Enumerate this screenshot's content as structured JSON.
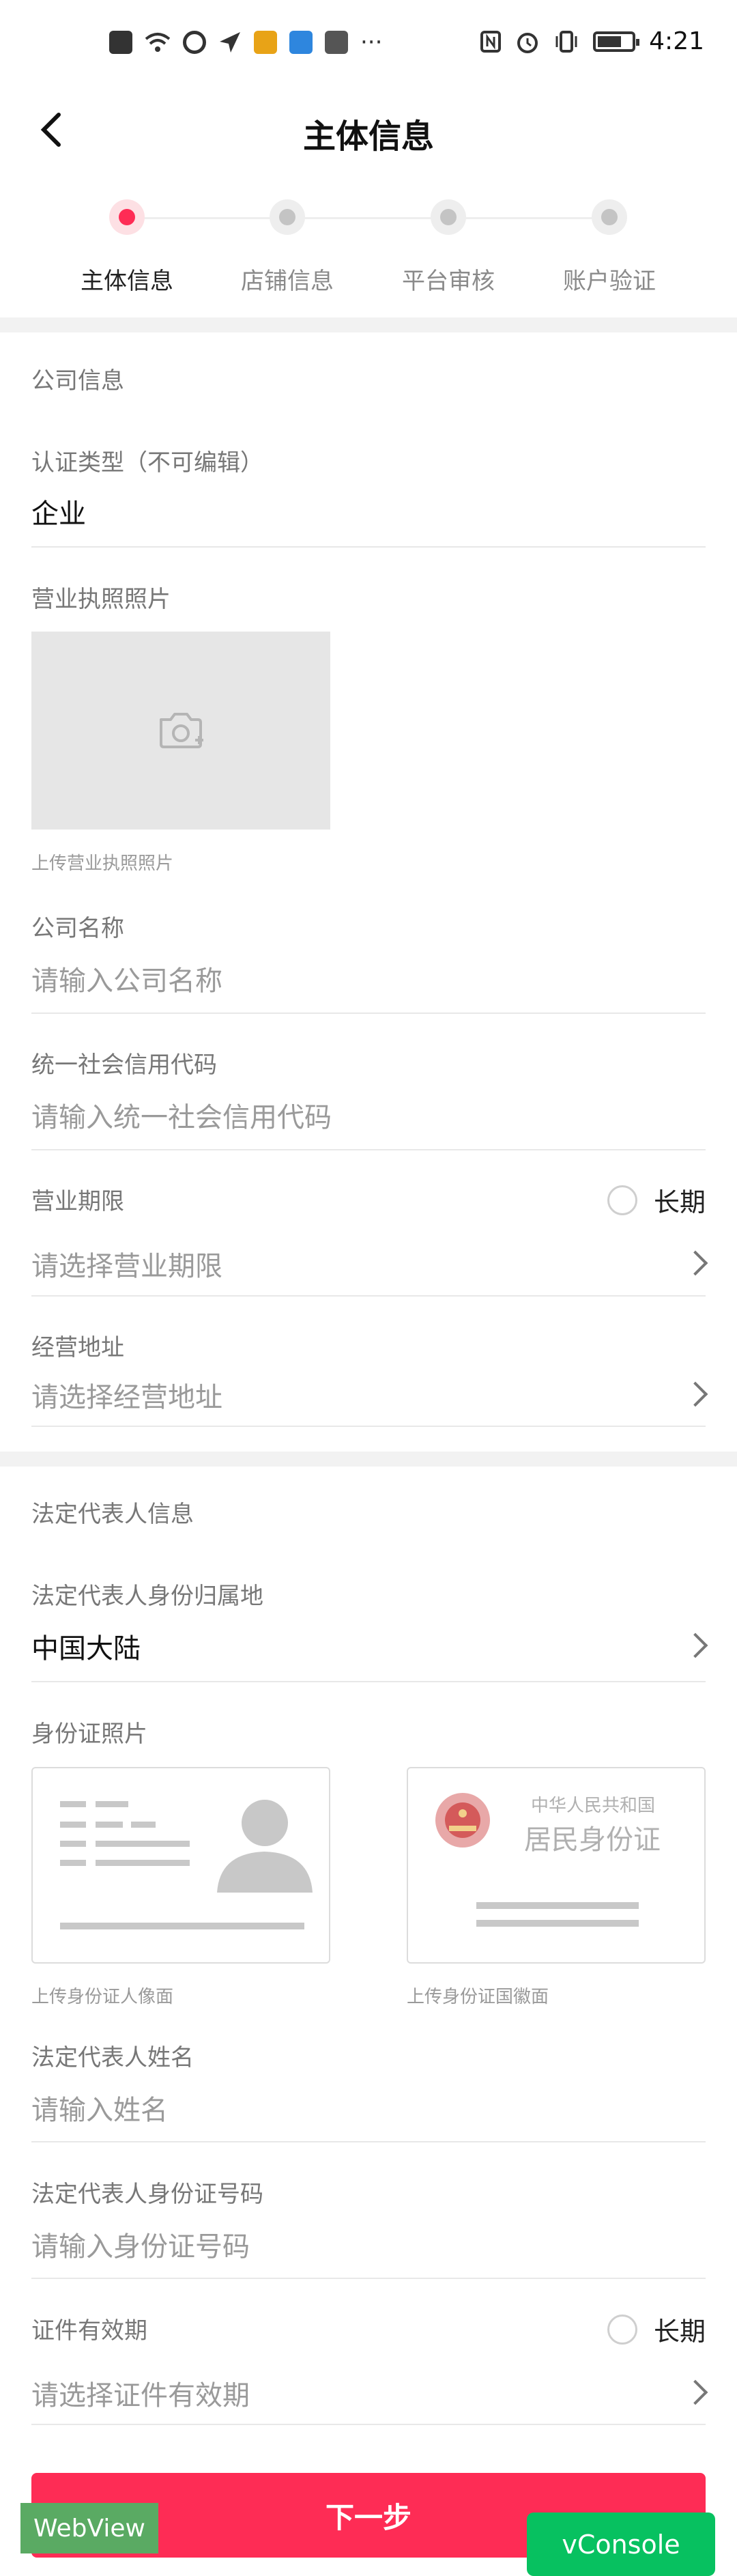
{
  "status_bar": {
    "time": "4:21",
    "left_icons": [
      "notification-icon",
      "wifi-icon",
      "shazam-icon",
      "location-icon",
      "app-icon",
      "gallery-icon",
      "mail-icon"
    ],
    "right_icons": [
      "nfc-icon",
      "alarm-icon",
      "vibrate-icon",
      "battery-icon"
    ],
    "more": "···"
  },
  "header": {
    "title": "主体信息",
    "back_icon": "chevron-left-icon"
  },
  "stepper": {
    "steps": [
      {
        "label": "主体信息",
        "active": true
      },
      {
        "label": "店铺信息",
        "active": false
      },
      {
        "label": "平台审核",
        "active": false
      },
      {
        "label": "账户验证",
        "active": false
      }
    ]
  },
  "company": {
    "section_title": "公司信息",
    "cert_type_label": "认证类型（不可编辑）",
    "cert_type_value": "企业",
    "license_photo_label": "营业执照照片",
    "license_upload_hint": "上传营业执照照片",
    "name_label": "公司名称",
    "name_placeholder": "请输入公司名称",
    "credit_code_label": "统一社会信用代码",
    "credit_code_placeholder": "请输入统一社会信用代码",
    "term_label": "营业期限",
    "term_long_label": "长期",
    "term_placeholder": "请选择营业期限",
    "address_label": "经营地址",
    "address_placeholder": "请选择经营地址"
  },
  "legal": {
    "section_title": "法定代表人信息",
    "region_label": "法定代表人身份归属地",
    "region_value": "中国大陆",
    "id_photo_label": "身份证照片",
    "id_front_hint": "上传身份证人像面",
    "id_back_hint": "上传身份证国徽面",
    "id_back_header_small": "中华人民共和国",
    "id_back_header_large": "居民身份证",
    "name_label": "法定代表人姓名",
    "name_placeholder": "请输入姓名",
    "id_number_label": "法定代表人身份证号码",
    "id_number_placeholder": "请输入身份证号码",
    "validity_label": "证件有效期",
    "validity_long_label": "长期",
    "validity_placeholder": "请选择证件有效期"
  },
  "footer": {
    "next_button": "下一步",
    "webview_tag": "WebView",
    "vconsole_button": "vConsole"
  },
  "colors": {
    "accent": "#fe2c55",
    "vconsole": "#07c160",
    "webview": "#5aaa63"
  }
}
